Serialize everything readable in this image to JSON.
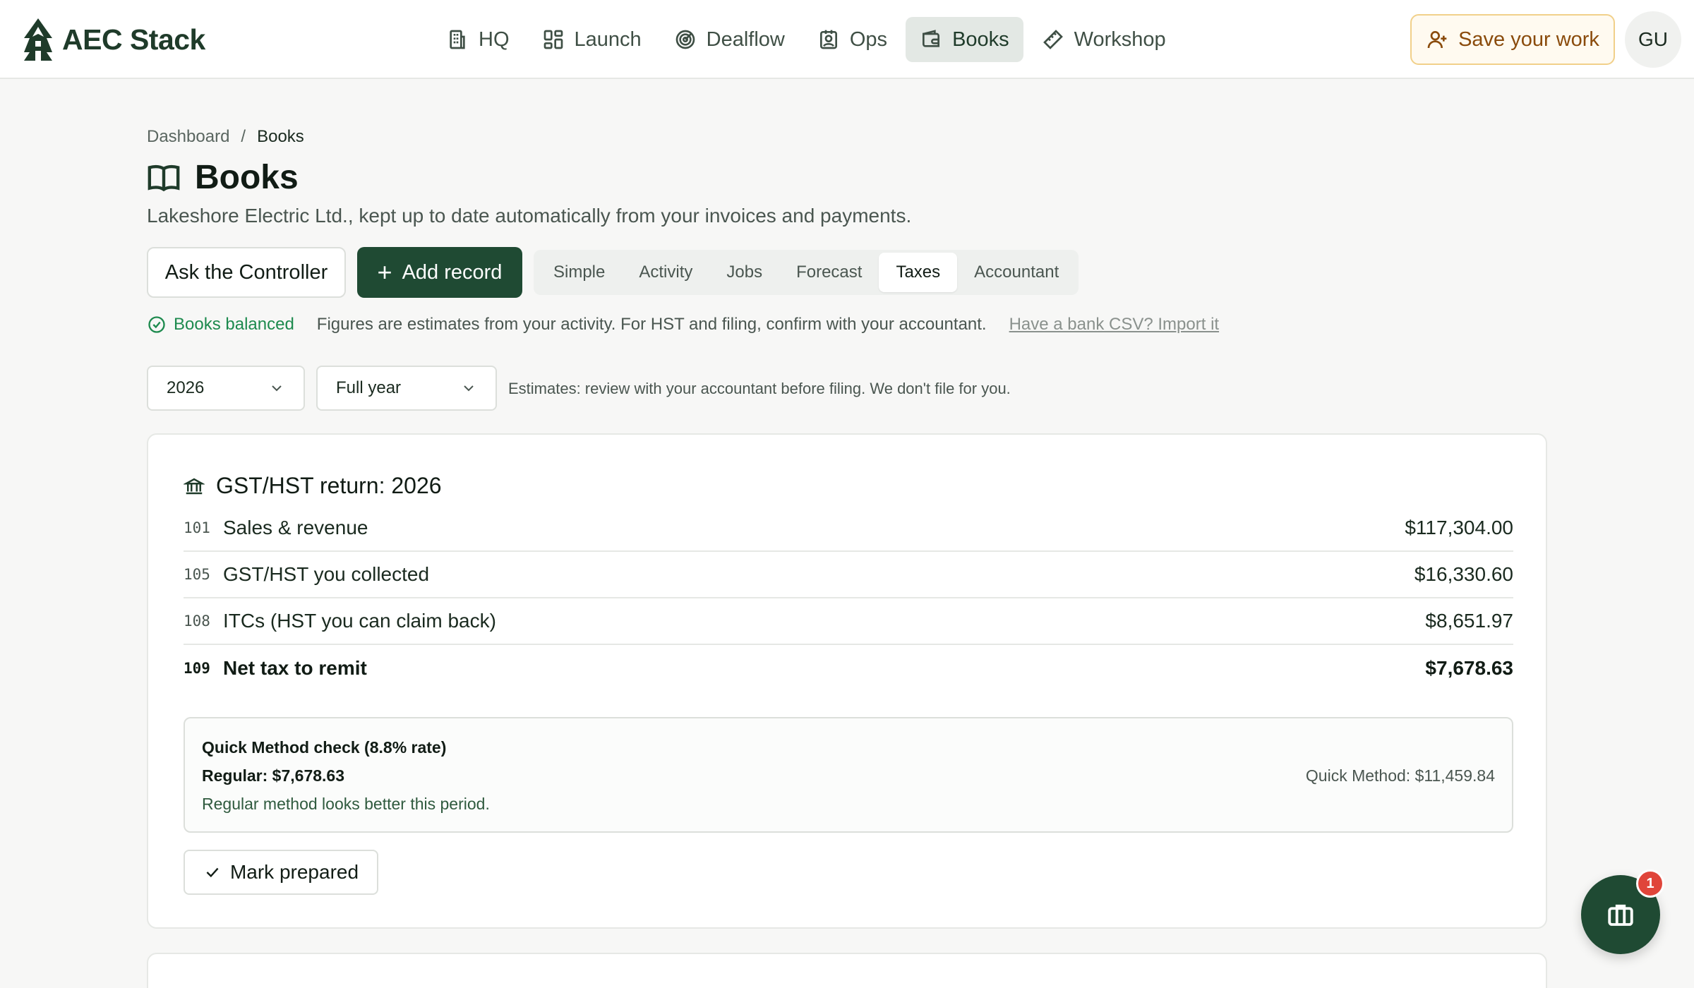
{
  "app": {
    "name": "AEC Stack"
  },
  "nav": [
    {
      "label": "HQ",
      "icon": "building-icon"
    },
    {
      "label": "Launch",
      "icon": "grid-icon"
    },
    {
      "label": "Dealflow",
      "icon": "target-icon"
    },
    {
      "label": "Ops",
      "icon": "id-badge-icon"
    },
    {
      "label": "Books",
      "icon": "wallet-icon",
      "active": true
    },
    {
      "label": "Workshop",
      "icon": "ruler-icon"
    }
  ],
  "header": {
    "save_label": "Save your work",
    "avatar_initials": "GU"
  },
  "breadcrumb": {
    "root": "Dashboard",
    "separator": "/",
    "current": "Books"
  },
  "page": {
    "title": "Books",
    "subtitle": "Lakeshore Electric Ltd., kept up to date automatically from your invoices and payments."
  },
  "actions": {
    "ask_label": "Ask the Controller",
    "add_label": "Add record"
  },
  "tabs": [
    {
      "label": "Simple"
    },
    {
      "label": "Activity"
    },
    {
      "label": "Jobs"
    },
    {
      "label": "Forecast"
    },
    {
      "label": "Taxes",
      "active": true
    },
    {
      "label": "Accountant"
    }
  ],
  "status": {
    "balanced_label": "Books balanced",
    "note": "Figures are estimates from your activity. For HST and filing, confirm with your accountant.",
    "import_link": "Have a bank CSV? Import it"
  },
  "filters": {
    "year": "2026",
    "period": "Full year",
    "note": "Estimates: review with your accountant before filing. We don't file for you."
  },
  "return_card": {
    "title": "GST/HST return: 2026",
    "rows": [
      {
        "code": "101",
        "label": "Sales & revenue",
        "amount": "$117,304.00"
      },
      {
        "code": "105",
        "label": "GST/HST you collected",
        "amount": "$16,330.60"
      },
      {
        "code": "108",
        "label": "ITCs (HST you can claim back)",
        "amount": "$8,651.97"
      },
      {
        "code": "109",
        "label": "Net tax to remit",
        "amount": "$7,678.63"
      }
    ],
    "quick_method": {
      "title": "Quick Method check (8.8% rate)",
      "regular": "Regular: $7,678.63",
      "note": "Regular method looks better this period.",
      "quick": "Quick Method: $11,459.84"
    },
    "mark_label": "Mark prepared"
  },
  "fab": {
    "badge": "1"
  },
  "colors": {
    "brand": "#1f4a33",
    "accent_warning": "#f1d08a",
    "success": "#1d8a4e",
    "badge": "#e0453a"
  }
}
